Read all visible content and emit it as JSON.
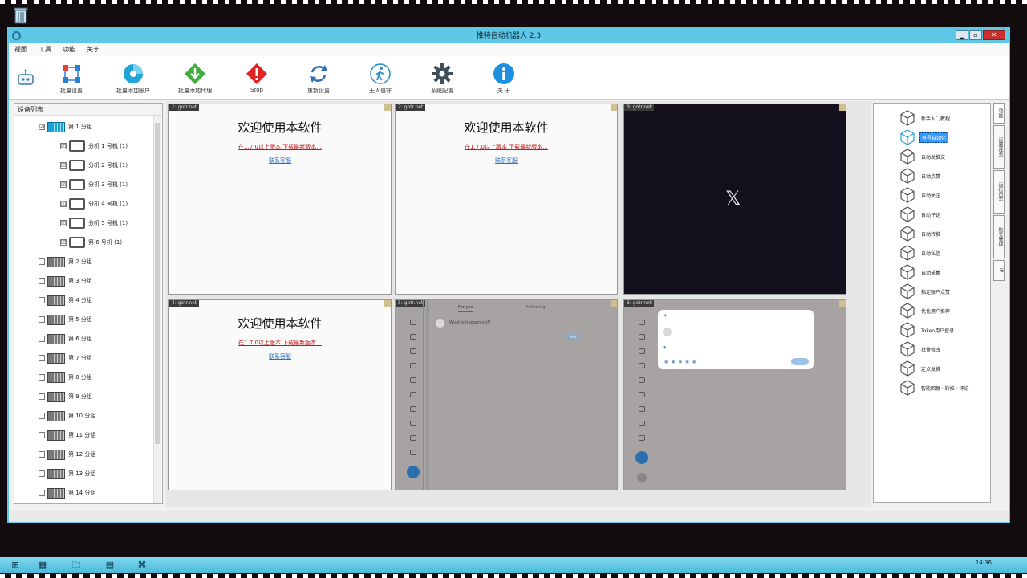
{
  "window": {
    "title": "推特自动机器人 2.3"
  },
  "menu": [
    {
      "label": "视图"
    },
    {
      "label": "工具"
    },
    {
      "label": "功能"
    },
    {
      "label": "关于"
    }
  ],
  "toolbar": [
    {
      "label": "批量设置",
      "icon": "grid-dots-icon"
    },
    {
      "label": "批量添加账户",
      "icon": "disc-icon"
    },
    {
      "label": "批量添加代理",
      "icon": "download-diamond-icon"
    },
    {
      "label": "Stop",
      "icon": "stop-warning-icon"
    },
    {
      "label": "重新设置",
      "icon": "refresh-icon"
    },
    {
      "label": "无人值守",
      "icon": "person-walk-icon"
    },
    {
      "label": "系统配置",
      "icon": "gear-icon"
    },
    {
      "label": "关 于",
      "icon": "info-icon"
    }
  ],
  "left_panel": {
    "title": "设备列表",
    "group1": {
      "label": "第 1 分组",
      "checked": "☑"
    },
    "phones": [
      {
        "label": "分机 1 号机  (1)",
        "checked": "☑"
      },
      {
        "label": "分机 2 号机  (1)",
        "checked": "☑"
      },
      {
        "label": "分机 3 号机  (1)",
        "checked": "☑"
      },
      {
        "label": "分机 4 号机  (1)",
        "checked": "☑"
      },
      {
        "label": "分机 5 号机  (1)",
        "checked": "☑"
      },
      {
        "label": "第 6 号机  (1)",
        "checked": "☑"
      }
    ],
    "groups": [
      {
        "label": "第 2 分组"
      },
      {
        "label": "第 3 分组"
      },
      {
        "label": "第 4 分组"
      },
      {
        "label": "第 5 分组"
      },
      {
        "label": "第 6 分组"
      },
      {
        "label": "第 7 分组"
      },
      {
        "label": "第 8 分组"
      },
      {
        "label": "第 9 分组"
      },
      {
        "label": "第 10 分组"
      },
      {
        "label": "第 11 分组"
      },
      {
        "label": "第 12 分组"
      },
      {
        "label": "第 13 分组"
      },
      {
        "label": "第 14 分组"
      }
    ]
  },
  "panes": [
    {
      "tag": "1: gotr.net",
      "heading": "欢迎使用本软件",
      "red": "在1.7.0以上版本 下载最新版本...",
      "link": "联系客服"
    },
    {
      "tag": "2: gotr.net",
      "heading": "欢迎使用本软件",
      "red": "在1.7.0以上版本 下载最新版本...",
      "link": "联系客服"
    },
    {
      "tag": "3: gotr.net",
      "logo": "𝕏"
    },
    {
      "tag": "4: gotr.net",
      "heading": "欢迎使用本软件",
      "red": "在1.7.0以上版本 下载最新版本...",
      "link": "联系客服"
    },
    {
      "tag": "5: gotr.net",
      "compose_text": "What is happening?!",
      "post_label": "Post",
      "tab_foryou": "For you",
      "tab_following": "Following"
    },
    {
      "tag": "6: gotr.net"
    }
  ],
  "right_panel": {
    "items": [
      {
        "label": "新手入门教程"
      },
      {
        "label": "养号自动化",
        "selected": true
      },
      {
        "label": "自动发推文"
      },
      {
        "label": "自动点赞"
      },
      {
        "label": "自动关注"
      },
      {
        "label": "自动评论"
      },
      {
        "label": "自动转推"
      },
      {
        "label": "自动私信"
      },
      {
        "label": "自动采集"
      },
      {
        "label": "指定账户点赞"
      },
      {
        "label": "优化用户推荐"
      },
      {
        "label": "Token用户登录"
      },
      {
        "label": "批量修改"
      },
      {
        "label": "定点发推"
      },
      {
        "label": "智能回复 · 转推 · 评论"
      }
    ],
    "tabs": [
      {
        "label": "功能"
      },
      {
        "label": "设置任务"
      },
      {
        "label": "运行日志"
      },
      {
        "label": "账号管理"
      },
      {
        "label": "IP"
      }
    ]
  },
  "taskbar": {
    "clock": "14:36",
    "start": "⊞",
    "apps": [
      "▦",
      "🗀",
      "▤",
      "⌘"
    ]
  },
  "colors": {
    "accent": "#5cc7e6",
    "selected": "#3399ff",
    "stop": "#e02424",
    "download": "#3fae3c"
  }
}
